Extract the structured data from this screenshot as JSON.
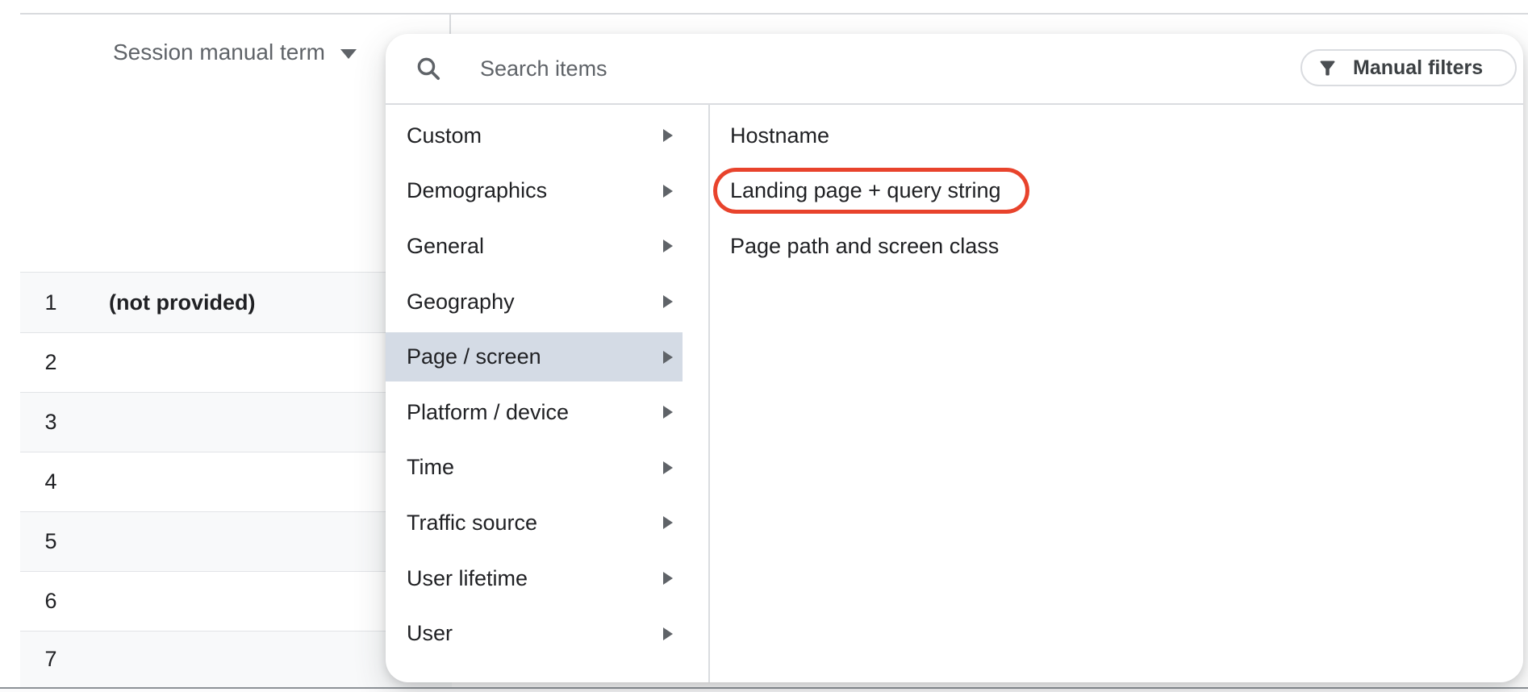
{
  "colors": {
    "ring": "#E8432C",
    "selected_bg": "#D4DBE5"
  },
  "table": {
    "header": "Session manual term",
    "rows": [
      {
        "num": "1",
        "term": "(not provided)"
      },
      {
        "num": "2",
        "term": ""
      },
      {
        "num": "3",
        "term": ""
      },
      {
        "num": "4",
        "term": ""
      },
      {
        "num": "5",
        "term": ""
      },
      {
        "num": "6",
        "term": ""
      },
      {
        "num": "7",
        "term": ""
      }
    ]
  },
  "panel": {
    "search_placeholder": "Search items",
    "manual_filters_label": "Manual filters",
    "categories": [
      {
        "label": "Custom",
        "selected": false
      },
      {
        "label": "Demographics",
        "selected": false
      },
      {
        "label": "General",
        "selected": false
      },
      {
        "label": "Geography",
        "selected": false
      },
      {
        "label": "Page / screen",
        "selected": true
      },
      {
        "label": "Platform / device",
        "selected": false
      },
      {
        "label": "Time",
        "selected": false
      },
      {
        "label": "Traffic source",
        "selected": false
      },
      {
        "label": "User lifetime",
        "selected": false
      },
      {
        "label": "User",
        "selected": false
      }
    ],
    "items": [
      {
        "label": "Hostname",
        "circled": false
      },
      {
        "label": "Landing page + query string",
        "circled": true
      },
      {
        "label": "Page path and screen class",
        "circled": false
      }
    ]
  }
}
